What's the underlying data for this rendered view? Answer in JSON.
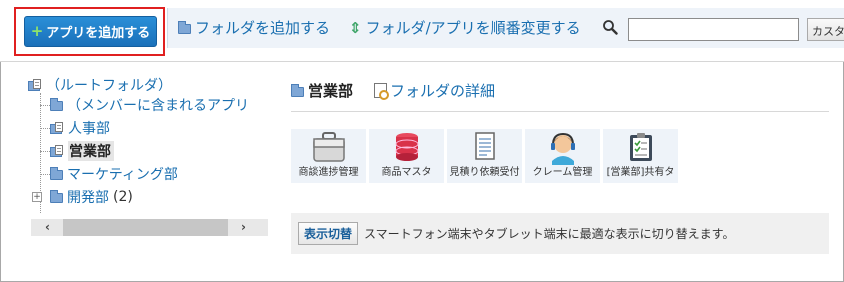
{
  "toolbar": {
    "add_app_label": "アプリを追加する",
    "add_folder_label": "フォルダを追加する",
    "reorder_label": "フォルダ/アプリを順番変更する",
    "search_placeholder": "",
    "customize_label": "カスタ"
  },
  "tree": {
    "root": "（ルートフォルダ）",
    "items": [
      {
        "label": "（メンバーに含まれるアプリ"
      },
      {
        "label": "人事部"
      },
      {
        "label": "営業部",
        "selected": true
      },
      {
        "label": "マーケティング部"
      },
      {
        "label": "開発部",
        "count": "(2)",
        "collapsed": true
      }
    ]
  },
  "main": {
    "folder_title": "営業部",
    "detail_link": "フォルダの詳細",
    "apps": [
      {
        "label": "商談進捗管理",
        "icon": "briefcase-icon"
      },
      {
        "label": "商品マスタ",
        "icon": "database-icon"
      },
      {
        "label": "見積り依頼受付",
        "icon": "document-icon"
      },
      {
        "label": "クレーム管理",
        "icon": "headset-person-icon"
      },
      {
        "label": "[営業部]共有タ",
        "icon": "clipboard-icon"
      }
    ],
    "switch_button": "表示切替",
    "switch_text": "スマートフォン端末やタブレット端末に最適な表示に切り替えます。"
  },
  "colors": {
    "accent": "#1a70b9",
    "link": "#1a6fb0",
    "highlight_border": "#e02020",
    "toolbar_band": "#eef3f9"
  }
}
